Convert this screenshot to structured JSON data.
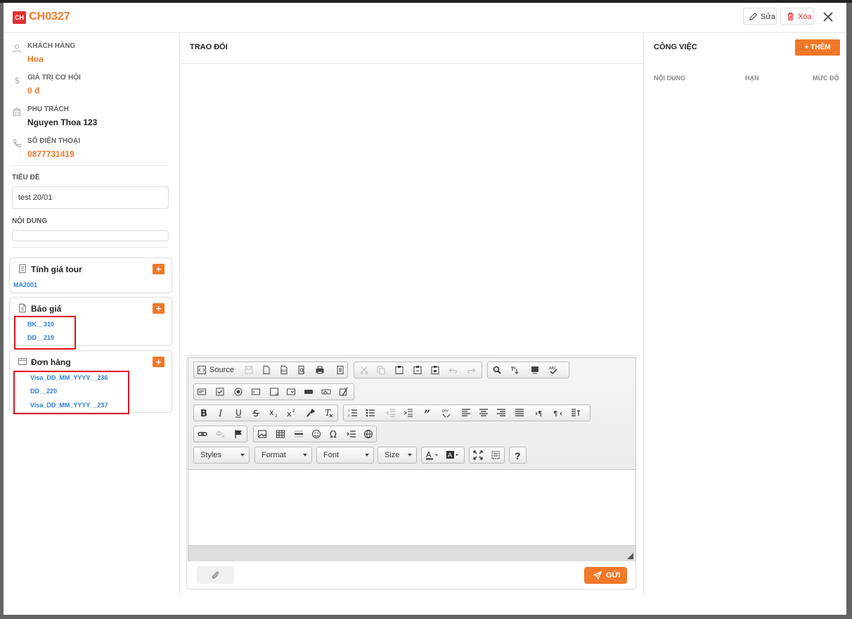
{
  "header": {
    "badge": "CH",
    "code": "CH0327",
    "edit_label": "Sửa",
    "delete_label": "Xóa"
  },
  "info": {
    "customer_label": "KHÁCH HÀNG",
    "customer_value": "Hoa",
    "opp_label": "GIÁ TRỊ CƠ HỘI",
    "opp_value": "0 đ",
    "owner_label": "PHỤ TRÁCH",
    "owner_value": "Nguyen Thoa 123",
    "phone_label": "SỐ ĐIỆN THOẠI",
    "phone_value": "0877731419"
  },
  "form": {
    "title_label": "TIÊU ĐỀ",
    "title_value": "test 20/01",
    "content_label": "NỘI DUNG"
  },
  "cards": {
    "tour": {
      "title": "Tính giá tour",
      "plus": "+",
      "items": [
        "MA2001"
      ]
    },
    "quote": {
      "title": "Báo giá",
      "plus": "+",
      "items": [
        "BK__310",
        "DD__219"
      ]
    },
    "order": {
      "title": "Đơn hàng",
      "plus": "+",
      "items": [
        "Visa_DD_MM_YYYY__236",
        "DD__220",
        "Visa_DD_MM_YYYY__237"
      ]
    }
  },
  "center": {
    "title": "TRAO ĐỔI",
    "source_label": "Source",
    "combos": {
      "styles": "Styles",
      "format": "Format",
      "font": "Font",
      "size": "Size"
    },
    "help": "?",
    "send_label": "GỬI"
  },
  "right": {
    "title": "CÔNG VIỆC",
    "add_label": "+ THÊM",
    "columns": [
      "NỘI DUNG",
      "HẠN",
      "MỨC ĐỘ"
    ]
  },
  "colors": {
    "accent": "#f07828",
    "danger": "#e03131",
    "link": "#2a7fd4"
  }
}
